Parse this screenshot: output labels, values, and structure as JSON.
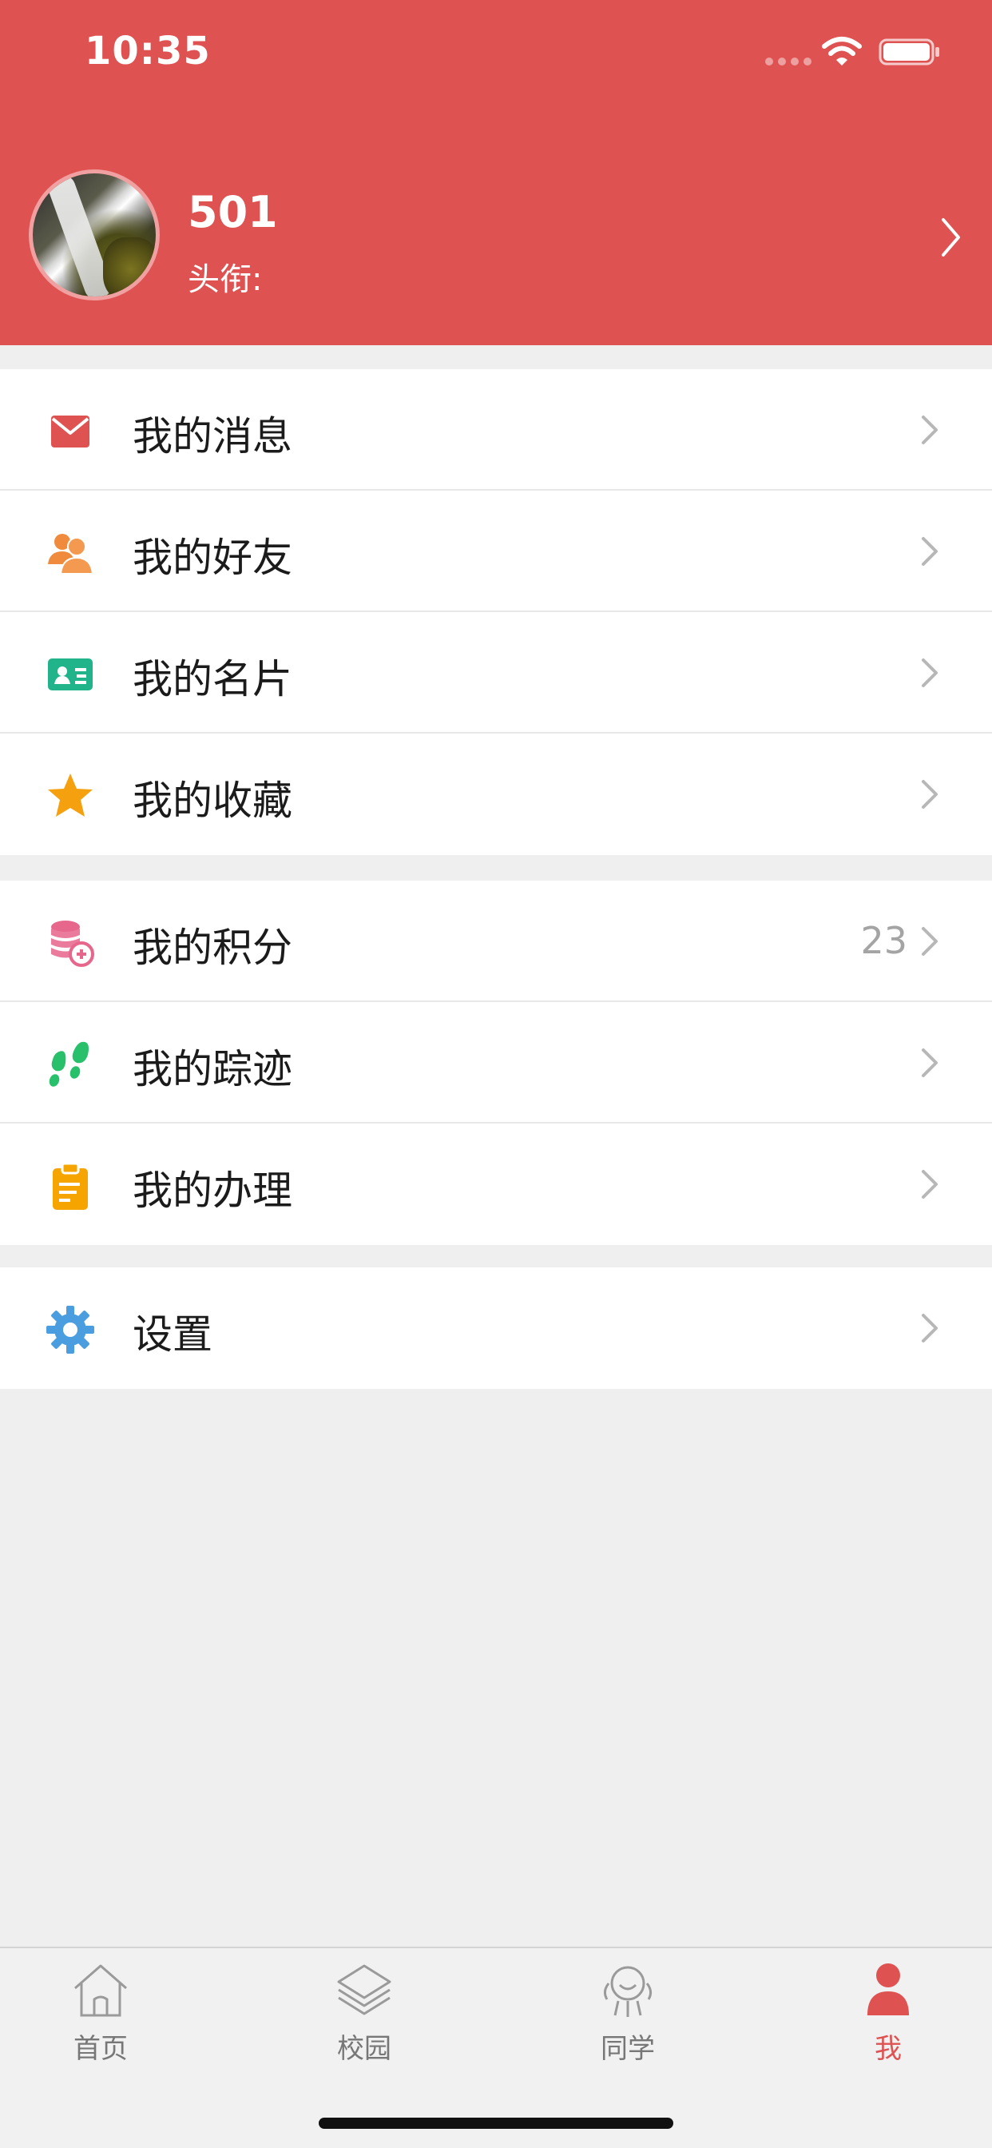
{
  "status_bar": {
    "time": "10:35"
  },
  "profile": {
    "name": "501",
    "title_label": "头衔:"
  },
  "menu_groups": [
    {
      "items": [
        {
          "label": "我的消息",
          "icon": "mail-icon",
          "color": "#df5252"
        },
        {
          "label": "我的好友",
          "icon": "friends-icon",
          "color": "#f08a3c"
        },
        {
          "label": "我的名片",
          "icon": "business-card-icon",
          "color": "#21b38a"
        },
        {
          "label": "我的收藏",
          "icon": "star-icon",
          "color": "#f5a00f"
        }
      ]
    },
    {
      "items": [
        {
          "label": "我的积分",
          "icon": "points-coins-icon",
          "color": "#e6668c",
          "value": "23"
        },
        {
          "label": "我的踪迹",
          "icon": "footprints-icon",
          "color": "#28c06a"
        },
        {
          "label": "我的办理",
          "icon": "clipboard-icon",
          "color": "#f5a400"
        }
      ]
    },
    {
      "items": [
        {
          "label": "设置",
          "icon": "gear-icon",
          "color": "#4a9ee0"
        }
      ]
    }
  ],
  "tabbar": {
    "tabs": [
      {
        "label": "首页",
        "icon": "home-icon"
      },
      {
        "label": "校园",
        "icon": "layers-icon"
      },
      {
        "label": "同学",
        "icon": "classmates-icon"
      },
      {
        "label": "我",
        "icon": "person-icon",
        "active": true
      }
    ],
    "active_color": "#df5252",
    "inactive_color": "#777777"
  },
  "colors": {
    "header_bg": "#df5252",
    "page_bg": "#efefef"
  }
}
